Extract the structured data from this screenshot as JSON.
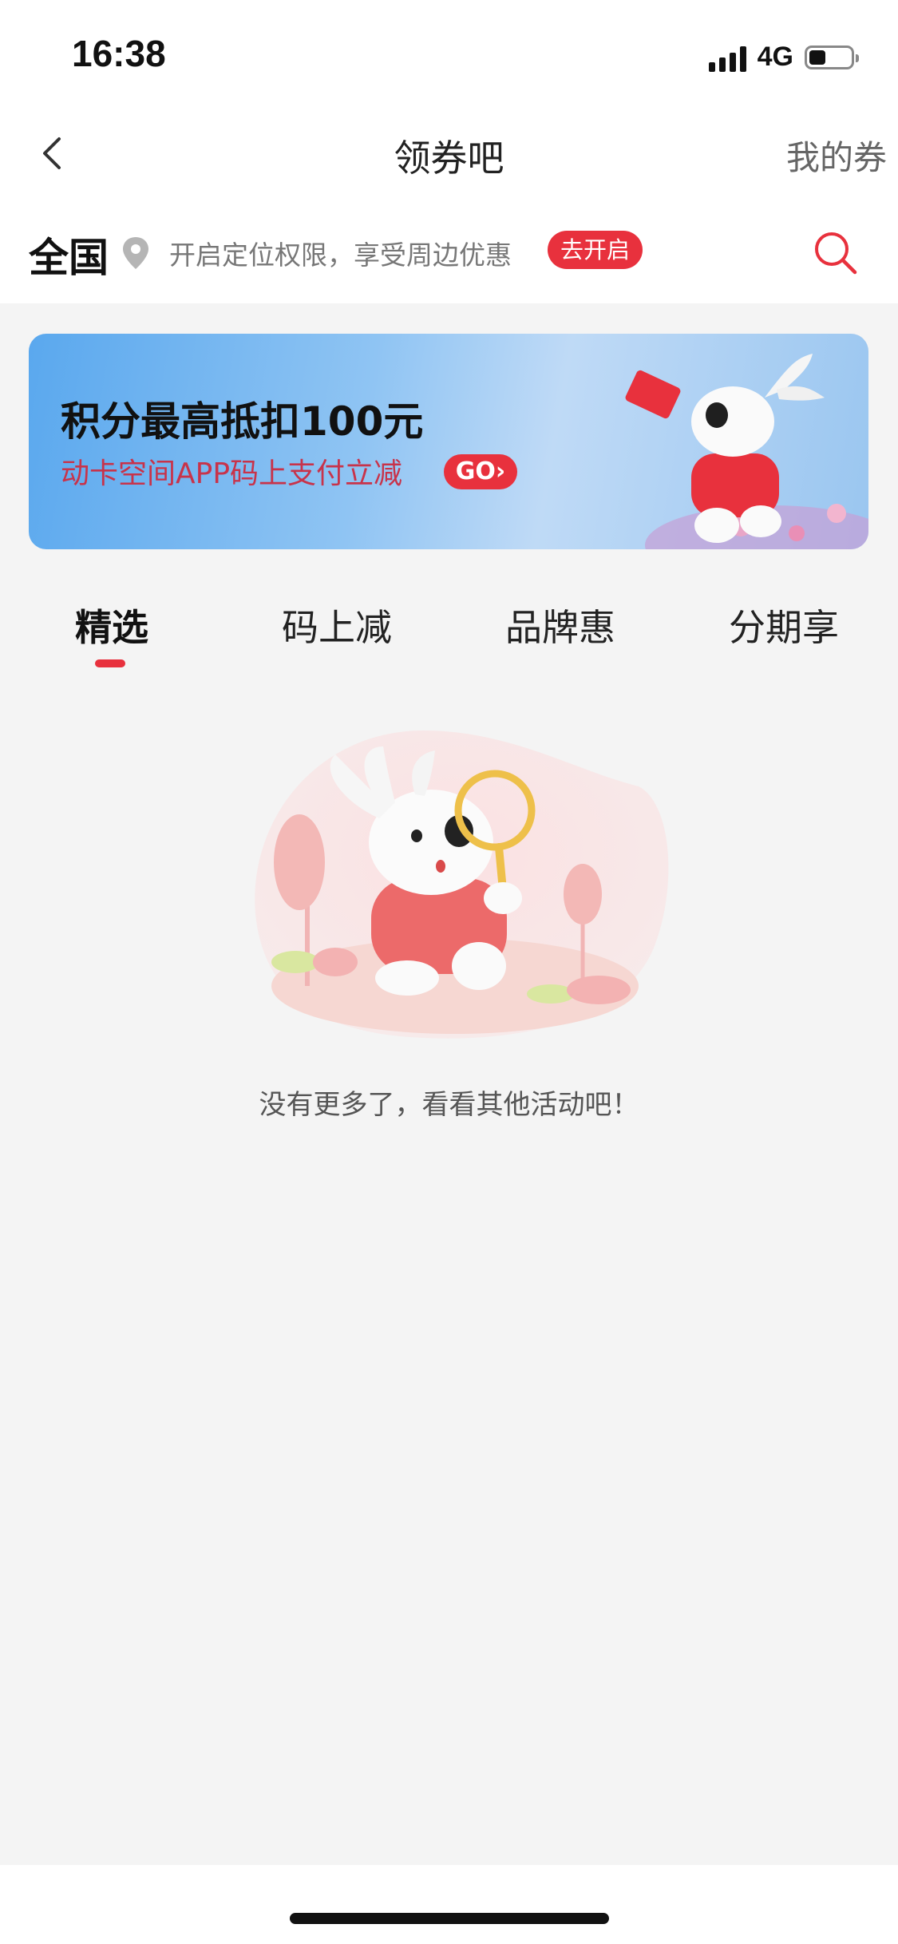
{
  "status_bar": {
    "time": "16:38",
    "network": "4G",
    "battery_level": 0.4
  },
  "nav": {
    "title": "领券吧",
    "right_link": "我的券",
    "back_icon": "chevron-left-icon"
  },
  "location": {
    "region": "全国",
    "tip": "开启定位权限，享受周边优惠",
    "enable_label": "去开启",
    "pin_icon": "location-pin-icon",
    "search_icon": "search-icon"
  },
  "banner": {
    "title": "积分最高抵扣100元",
    "subtitle": "动卡空间APP码上支付立减",
    "go_label": "GO›"
  },
  "tabs": [
    {
      "label": "精选",
      "active": true
    },
    {
      "label": "码上减",
      "active": false
    },
    {
      "label": "品牌惠",
      "active": false
    },
    {
      "label": "分期享",
      "active": false
    }
  ],
  "empty_state": {
    "message": "没有更多了，看看其他活动吧！"
  },
  "colors": {
    "accent": "#e8313d",
    "banner_sub": "#c8334a",
    "background": "#f4f4f4"
  }
}
